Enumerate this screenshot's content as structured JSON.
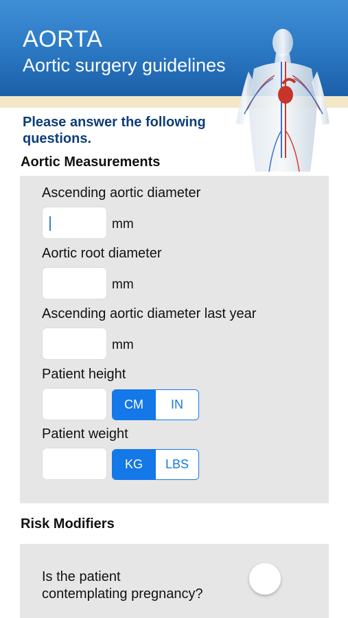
{
  "header": {
    "title": "AORTA",
    "subtitle": "Aortic surgery guidelines",
    "illustration": "human-circulatory-anatomy"
  },
  "prompt": "Please answer the following questions.",
  "measurements": {
    "section_title": "Aortic Measurements",
    "ascending_label": "Ascending aortic diameter",
    "ascending_value": "",
    "ascending_unit": "mm",
    "root_label": "Aortic root diameter",
    "root_value": "",
    "root_unit": "mm",
    "last_year_label": "Ascending aortic diameter last year",
    "last_year_value": "",
    "last_year_unit": "mm",
    "height_label": "Patient height",
    "height_value": "",
    "height_units": [
      "CM",
      "IN"
    ],
    "height_selected": "CM",
    "weight_label": "Patient weight",
    "weight_value": "",
    "weight_units": [
      "KG",
      "LBS"
    ],
    "weight_selected": "KG"
  },
  "risk": {
    "section_title": "Risk Modifiers",
    "pregnancy_line1": "Is the patient",
    "pregnancy_line2": "contemplating pregnancy?",
    "pregnancy_on": false
  },
  "colors": {
    "header_blue": "#2e7cc7",
    "prompt_navy": "#0d3d78",
    "accent": "#1478e8",
    "panel_gray": "#e6e6e6"
  }
}
